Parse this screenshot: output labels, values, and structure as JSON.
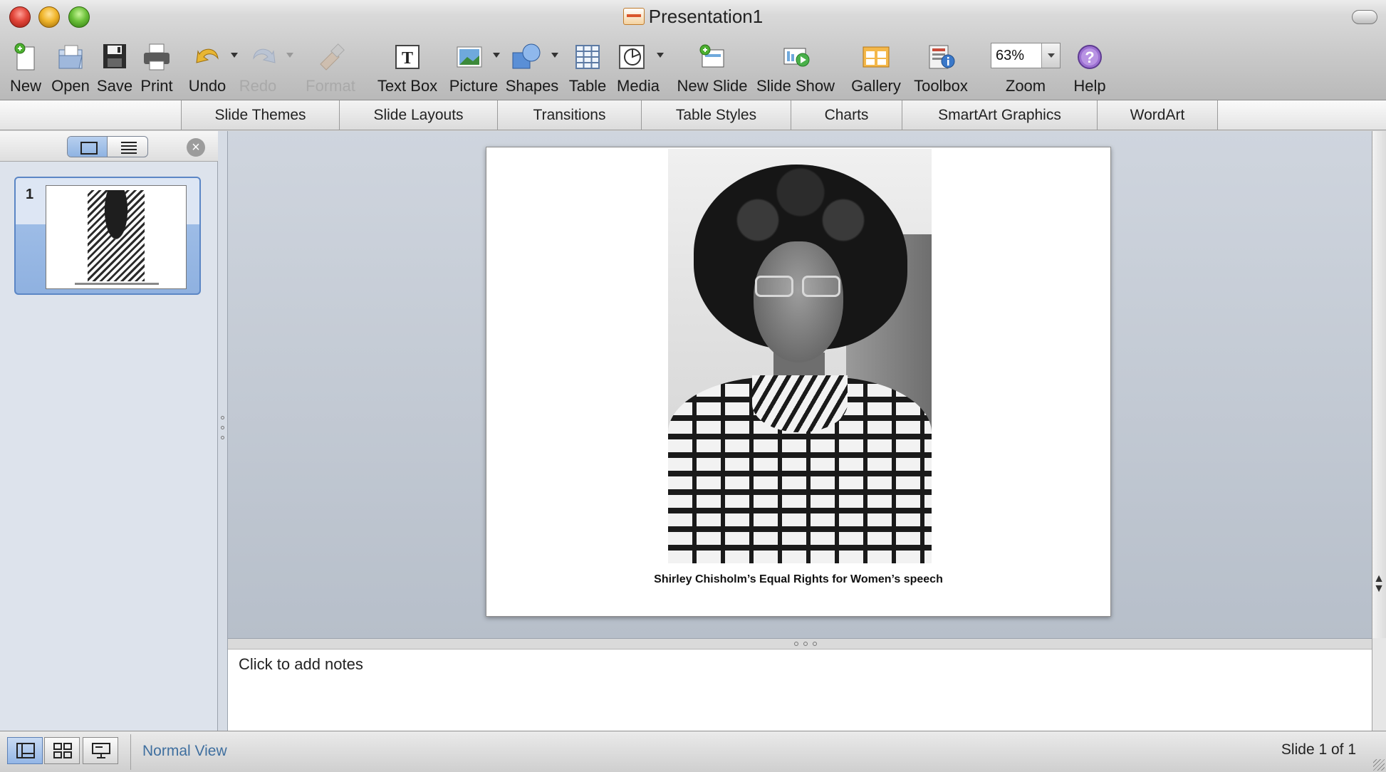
{
  "window": {
    "title": "Presentation1"
  },
  "toolbar": {
    "items": [
      {
        "label": "New",
        "icon": "new-document-icon"
      },
      {
        "label": "Open",
        "icon": "open-folder-icon"
      },
      {
        "label": "Save",
        "icon": "floppy-disk-icon"
      },
      {
        "label": "Print",
        "icon": "printer-icon"
      },
      {
        "label": "Undo",
        "icon": "undo-arrow-icon"
      },
      {
        "label": "Redo",
        "icon": "redo-arrow-icon",
        "disabled": true
      },
      {
        "label": "Format",
        "icon": "format-brush-icon",
        "disabled": true
      },
      {
        "label": "Text Box",
        "icon": "text-box-icon"
      },
      {
        "label": "Picture",
        "icon": "picture-icon"
      },
      {
        "label": "Shapes",
        "icon": "shapes-icon"
      },
      {
        "label": "Table",
        "icon": "table-icon"
      },
      {
        "label": "Media",
        "icon": "media-icon"
      },
      {
        "label": "New Slide",
        "icon": "new-slide-icon"
      },
      {
        "label": "Slide Show",
        "icon": "slide-show-icon"
      },
      {
        "label": "Gallery",
        "icon": "gallery-icon"
      },
      {
        "label": "Toolbox",
        "icon": "toolbox-icon"
      },
      {
        "label": "Zoom",
        "icon": "zoom-dropdown"
      },
      {
        "label": "Help",
        "icon": "help-icon"
      }
    ],
    "zoom_value": "63%"
  },
  "ribbon": {
    "tabs": [
      "Slide Themes",
      "Slide Layouts",
      "Transitions",
      "Table Styles",
      "Charts",
      "SmartArt Graphics",
      "WordArt"
    ]
  },
  "slides_pane": {
    "slide_number": "1"
  },
  "slide": {
    "caption": "Shirley Chisholm’s Equal Rights for Women’s speech"
  },
  "notes": {
    "placeholder": "Click to add notes"
  },
  "statusbar": {
    "view_name": "Normal View",
    "slide_counter": "Slide 1 of 1"
  },
  "colors": {
    "accent_blue": "#3f6f9f",
    "stage_bg": "#c3cad4",
    "selected_thumb": "#8fb1e0"
  }
}
